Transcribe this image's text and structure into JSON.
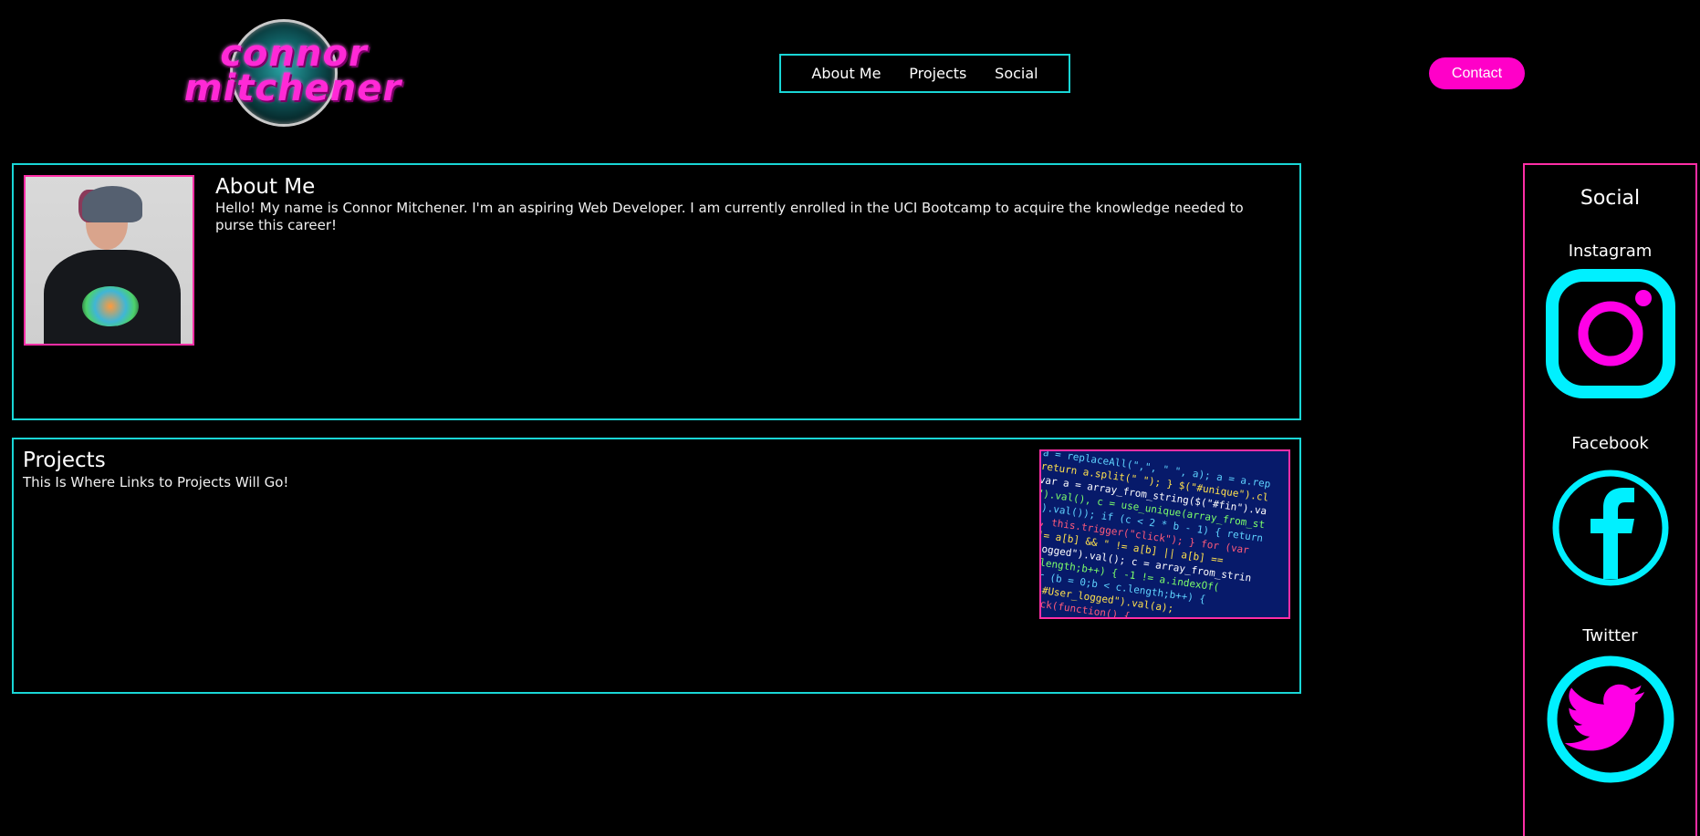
{
  "header": {
    "logo_line1": "connor",
    "logo_line2": "mitchener",
    "nav": [
      "About Me",
      "Projects",
      "Social"
    ],
    "contact_label": "Contact"
  },
  "about": {
    "title": "About Me",
    "text": "Hello! My name is Connor Mitchener. I'm an aspiring Web Developer. I am currently enrolled in the UCI Bootcamp to acquire the knowledge needed to purse this career!"
  },
  "projects": {
    "title": "Projects",
    "text": "This Is Where Links to Projects Will Go!"
  },
  "social": {
    "title": "Social",
    "items": [
      {
        "label": "Instagram",
        "icon": "instagram-icon"
      },
      {
        "label": "Facebook",
        "icon": "facebook-icon"
      },
      {
        "label": "Twitter",
        "icon": "twitter-icon"
      }
    ]
  },
  "colors": {
    "accent_cyan": "#19d6d6",
    "accent_pink": "#ff2ea6",
    "contact_pink": "#ff00c8",
    "icon_magenta": "#ff00e6",
    "background": "#000000"
  }
}
